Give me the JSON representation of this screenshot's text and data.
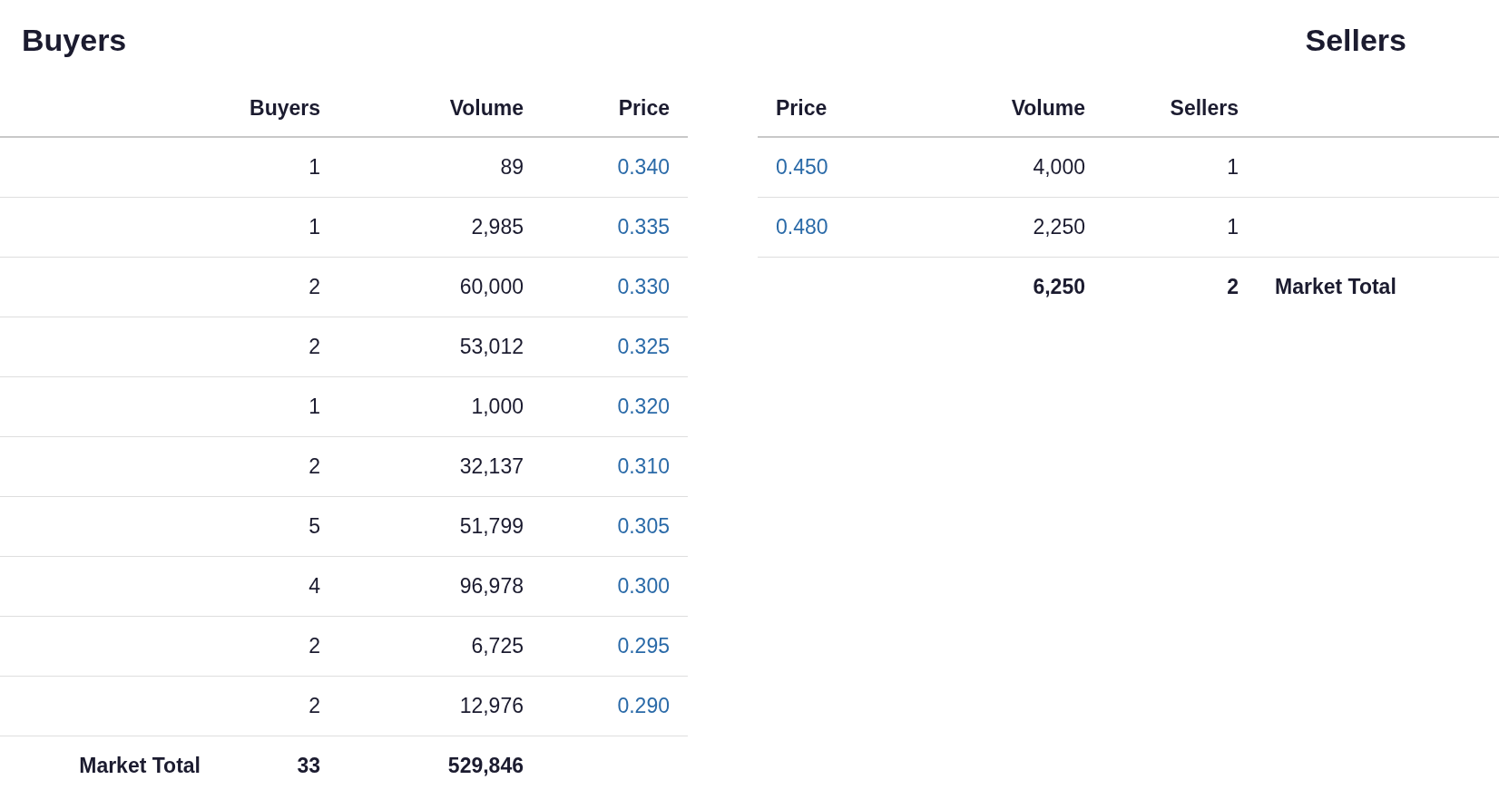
{
  "buyers": {
    "title": "Buyers",
    "columns": [
      "Buyers",
      "Volume",
      "Price"
    ],
    "rows": [
      {
        "buyers": "1",
        "volume": "89",
        "price": "0.340"
      },
      {
        "buyers": "1",
        "volume": "2,985",
        "price": "0.335"
      },
      {
        "buyers": "2",
        "volume": "60,000",
        "price": "0.330"
      },
      {
        "buyers": "2",
        "volume": "53,012",
        "price": "0.325"
      },
      {
        "buyers": "1",
        "volume": "1,000",
        "price": "0.320"
      },
      {
        "buyers": "2",
        "volume": "32,137",
        "price": "0.310"
      },
      {
        "buyers": "5",
        "volume": "51,799",
        "price": "0.305"
      },
      {
        "buyers": "4",
        "volume": "96,978",
        "price": "0.300"
      },
      {
        "buyers": "2",
        "volume": "6,725",
        "price": "0.295"
      },
      {
        "buyers": "2",
        "volume": "12,976",
        "price": "0.290"
      }
    ],
    "total": {
      "label": "Market Total",
      "buyers": "33",
      "volume": "529,846"
    }
  },
  "sellers": {
    "title": "Sellers",
    "columns": [
      "Price",
      "Volume",
      "Sellers"
    ],
    "rows": [
      {
        "price": "0.450",
        "volume": "4,000",
        "sellers": "1"
      },
      {
        "price": "0.480",
        "volume": "2,250",
        "sellers": "1"
      }
    ],
    "total": {
      "volume": "6,250",
      "sellers": "2",
      "label": "Market Total"
    }
  }
}
